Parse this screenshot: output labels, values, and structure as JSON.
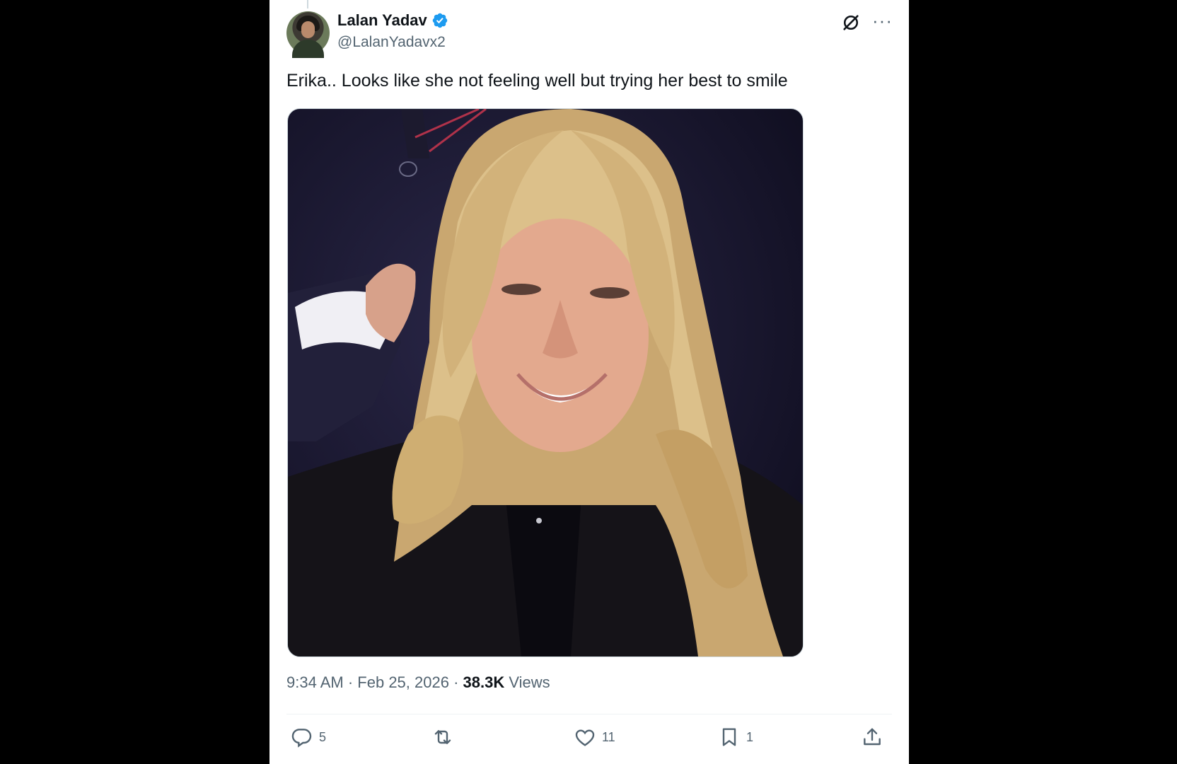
{
  "tweet": {
    "author": {
      "display_name": "Lalan Yadav",
      "handle": "@LalanYadavx2",
      "verified": true
    },
    "text": "Erika.. Looks like she not feeling well but trying her best to smile",
    "time": "9:34 AM",
    "date": "Feb 25, 2026",
    "separator": "·",
    "views_count": "38.3K",
    "views_label": "Views",
    "stats": {
      "replies": "5",
      "reposts": "",
      "likes": "11",
      "bookmarks": "1"
    }
  },
  "icons": {
    "verified": "verified-badge-icon",
    "grok": "grok-icon",
    "more": "more-icon",
    "reply": "reply-icon",
    "repost": "repost-icon",
    "like": "like-icon",
    "bookmark": "bookmark-icon",
    "share": "share-icon"
  },
  "colors": {
    "background": "#000000",
    "card": "#ffffff",
    "text": "#0f1419",
    "secondary": "#536471",
    "verified": "#1d9bf0"
  }
}
